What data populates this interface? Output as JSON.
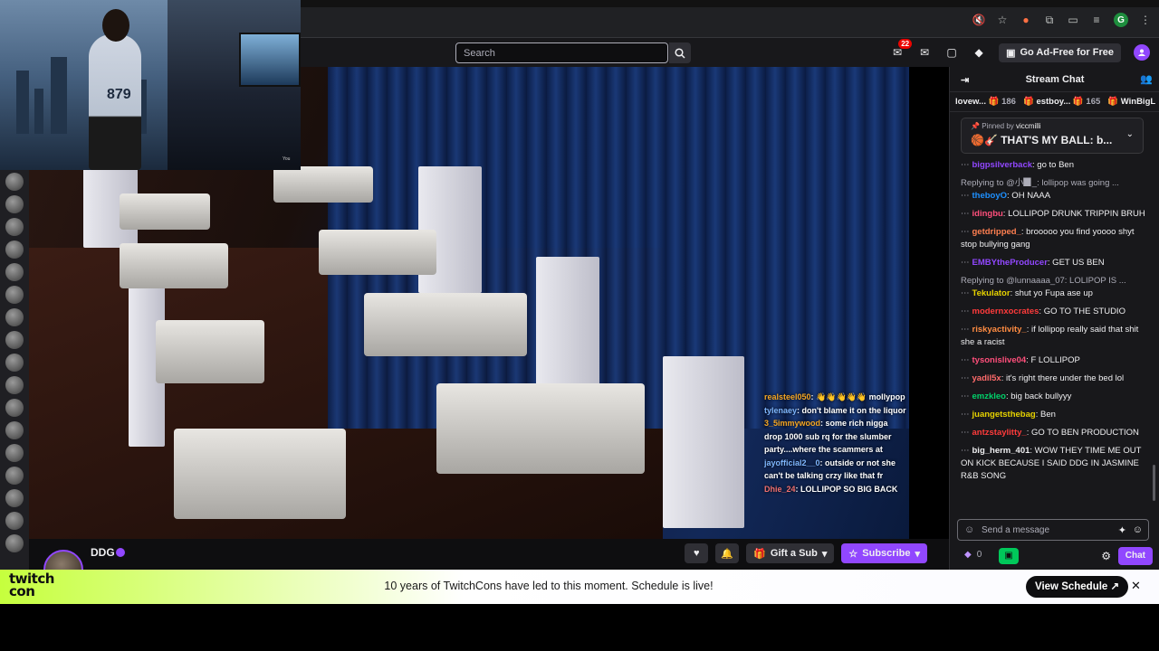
{
  "search": {
    "placeholder": "Search"
  },
  "topnav": {
    "notif_count": "22",
    "adfree_label": "Go Ad-Free for Free"
  },
  "webcam": {
    "jersey_number": "879",
    "corner_label": "You"
  },
  "overlay_chat": [
    {
      "user": "realsteel050",
      "text": ": 👋👋👋👋👋 mollypop",
      "color": "u1"
    },
    {
      "user": "tylenaey",
      "text": ": don't blame it on the liquor",
      "color": "u2"
    },
    {
      "user": "3_5immywood",
      "text": ": some rich nigga drop 1000 sub rq for the slumber party....where the scammers at",
      "color": "u1"
    },
    {
      "user": "jayofficial2__0",
      "text": ": outside or not she can't be talking crzy like that fr",
      "color": "u2"
    },
    {
      "user": "Dhie_24",
      "text": ": LOLLIPOP SO BIG BACK",
      "color": "u3"
    }
  ],
  "channel": {
    "name": "DDG",
    "gift_label": "Gift a Sub",
    "subscribe_label": "Subscribe"
  },
  "chat": {
    "title": "Stream Chat",
    "leaderboard": [
      {
        "name": "lovew...",
        "count": "186"
      },
      {
        "name": "estboy...",
        "count": "165"
      },
      {
        "name": "WinBigL",
        "count": ""
      }
    ],
    "pinned_by_label": "Pinned by",
    "pinned_by_user": "viccmilli",
    "pinned_text": "🏀🎸 THAT'S MY BALL: b...",
    "messages": [
      {
        "reply": "",
        "name": "bigpsilverback",
        "color": "#9147ff",
        "text": ": go to Ben"
      },
      {
        "reply": "Replying to @小▉_: lollipop was going ...",
        "name": "theboyO",
        "color": "#1e90ff",
        "text": ": OH NAAA"
      },
      {
        "reply": "",
        "name": "idingbu",
        "color": "#ff4f7b",
        "text": ": LOLLIPOP DRUNK TRIPPIN BRUH"
      },
      {
        "reply": "",
        "name": "getdripped_",
        "color": "#ff7f50",
        "text": ": brooooo you find yoooo shyt stop bullying gang"
      },
      {
        "reply": "",
        "name": "EMBYtheProducer",
        "color": "#9147ff",
        "text": ": GET US BEN"
      },
      {
        "reply": "Replying to @lunnaaaa_07: LOLIPOP IS ...",
        "name": "Tekulator",
        "color": "#e6d200",
        "text": ": shut yo Fupa ase up"
      },
      {
        "reply": "",
        "name": "modernxocrates",
        "color": "#ff3b3b",
        "text": ": GO TO THE STUDIO"
      },
      {
        "reply": "",
        "name": "riskyactivity_",
        "color": "#ff8c42",
        "text": ": if lollipop really said that shit she a racist"
      },
      {
        "reply": "",
        "name": "tysonislive04",
        "color": "#ff4f7b",
        "text": ": F LOLLIPOP"
      },
      {
        "reply": "",
        "name": "yadil5x",
        "color": "#ff6b6b",
        "text": ": it's right there under the bed lol"
      },
      {
        "reply": "",
        "name": "emzkleo",
        "color": "#00d26a",
        "text": ": big back bullyyy"
      },
      {
        "reply": "",
        "name": "juangetsthebag",
        "color": "#e6d200",
        "text": ": Ben"
      },
      {
        "reply": "",
        "name": "antzstaylitty_",
        "color": "#ff3b3b",
        "text": ": GO TO BEN PRODUCTION"
      },
      {
        "reply": "",
        "name": "big_herm_401",
        "color": "#efeff1",
        "text": ": WOW THEY TIME ME OUT ON KICK BECAUSE I SAID DDG IN JASMINE R&B SONG"
      }
    ],
    "input_placeholder": "Send a message",
    "points": "0",
    "chat_button": "Chat"
  },
  "banner": {
    "logo_line1": "twitch",
    "logo_line2": "con",
    "message": "10 years of TwitchCons have led to this moment. Schedule is live!",
    "cta": "View Schedule ↗",
    "close": "✕"
  }
}
